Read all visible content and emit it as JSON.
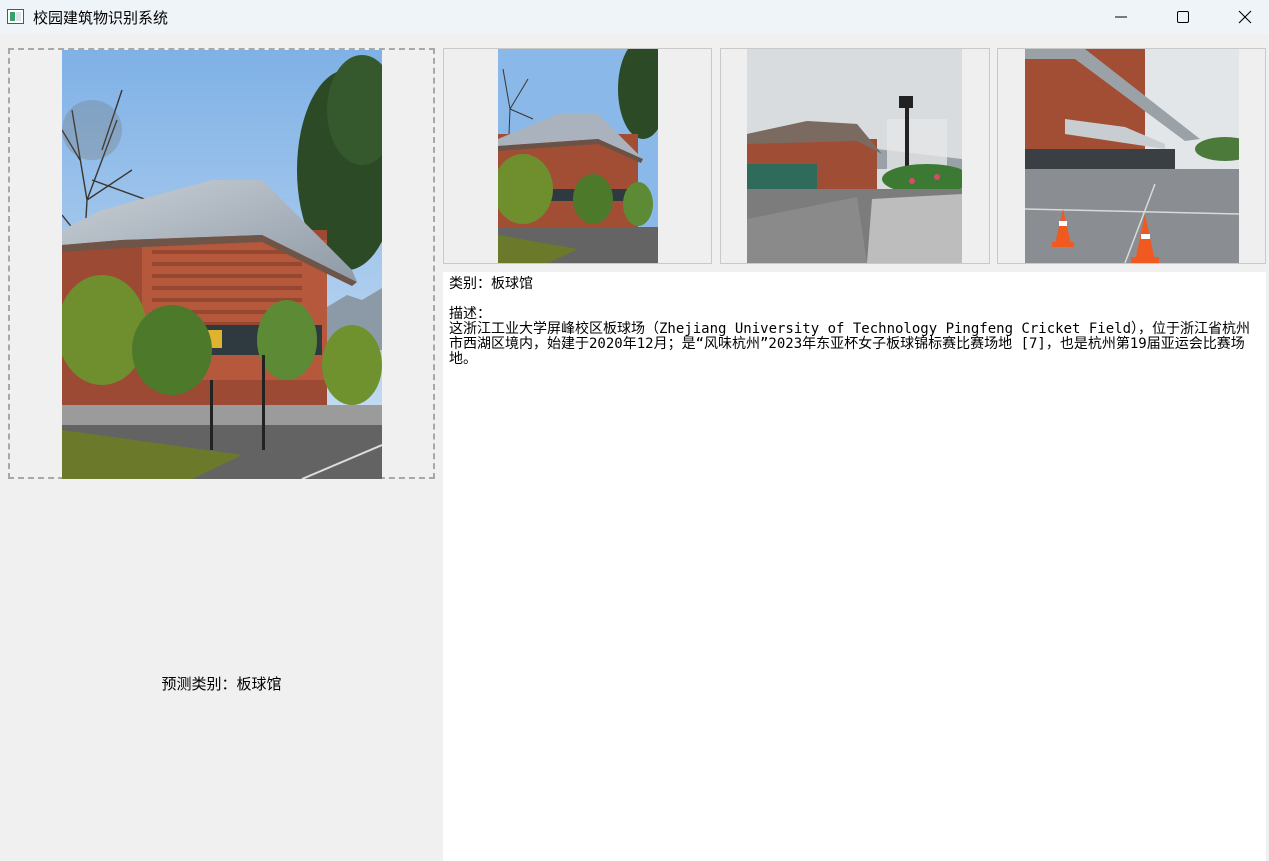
{
  "window": {
    "title": "校园建筑物识别系统",
    "app_icon": "app-window-icon",
    "controls": [
      "minimize-icon",
      "maximize-icon",
      "close-icon"
    ]
  },
  "main_image": {
    "alt": "板球馆"
  },
  "prediction": {
    "text": "预测类别：板球馆"
  },
  "thumbnails": [
    {
      "alt": "板球馆 1"
    },
    {
      "alt": "板球馆 2"
    },
    {
      "alt": "板球馆 3"
    }
  ],
  "info": {
    "category_line": "类别：板球馆",
    "description_label": "描述：",
    "description": "这浙江工业大学屏峰校区板球场（Zhejiang University of Technology Pingfeng Cricket Field），位于浙江省杭州市西湖区境内，始建于2020年12月；是“风味杭州”2023年东亚杯女子板球锦标赛比赛场地 [7]，也是杭州第19届亚运会比赛场地。"
  }
}
